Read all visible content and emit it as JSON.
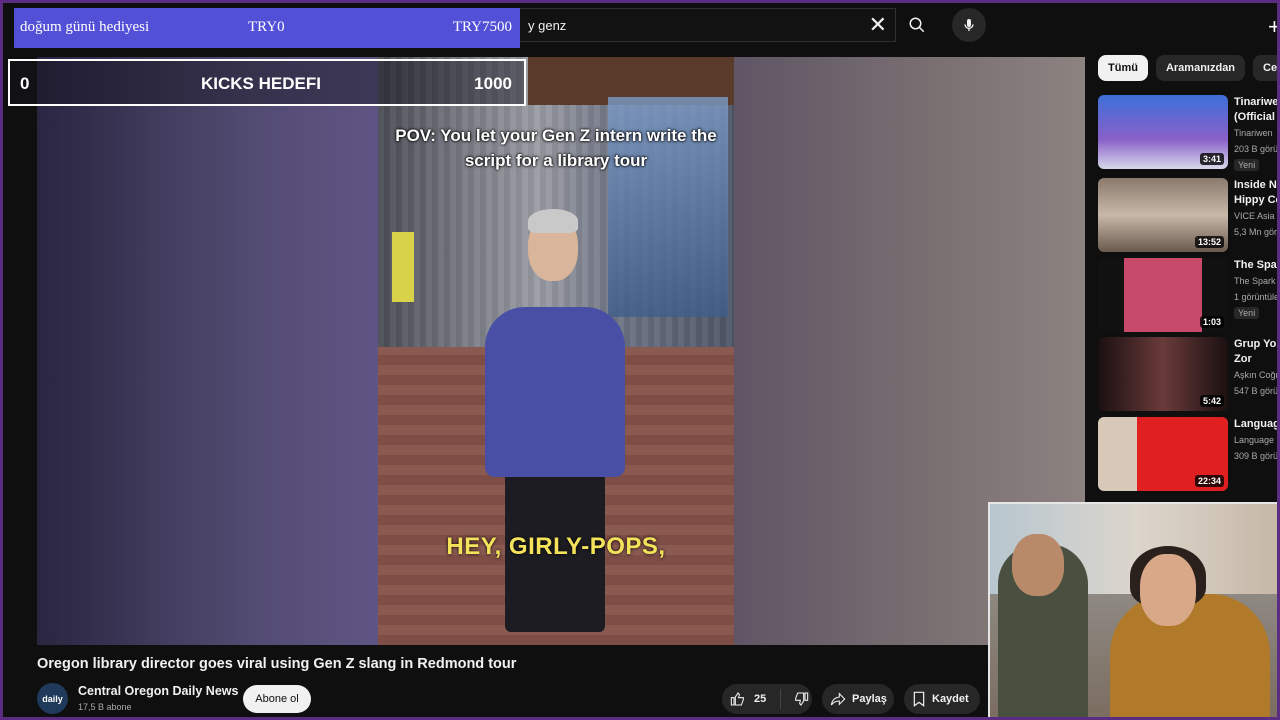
{
  "search": {
    "query": "y genz"
  },
  "overlays": {
    "gift": {
      "label": "doğum günü hediyesi",
      "current": "TRY0",
      "target": "TRY7500"
    },
    "kicks": {
      "min": "0",
      "label": "KICKS HEDEFI",
      "max": "1000"
    }
  },
  "video": {
    "caption_top": "POV: You let your Gen Z intern write the script for a library tour",
    "caption_bottom": "HEY, GIRLY-POPS,",
    "title": "Oregon library director goes viral using Gen Z slang in Redmond tour",
    "channel": {
      "name": "Central Oregon Daily News",
      "subscribers": "17,5 B abone",
      "avatar_text": "daily"
    },
    "subscribe_label": "Abone ol",
    "likes": "25",
    "share_label": "Paylaş",
    "save_label": "Kaydet"
  },
  "chips": [
    "Tümü",
    "Aramanızdan",
    "Centra"
  ],
  "recommendations": [
    {
      "title1": "Tinariwen",
      "title2": "(Official M",
      "channel": "Tinariwen",
      "views": "203 B görü",
      "new": "Yeni",
      "duration": "3:41"
    },
    {
      "title1": "Inside Ne",
      "title2": "Hippy Co",
      "channel": "VICE Asia",
      "views": "5,3 Mn gör",
      "new": "",
      "duration": "13:52"
    },
    {
      "title1": "The Spark",
      "title2": "",
      "channel": "The Spark",
      "views": "1 görüntüle",
      "new": "Yeni",
      "duration": "1:03"
    },
    {
      "title1": "Grup Yoru",
      "title2": "Zor",
      "channel": "Aşkın Coğr",
      "views": "547 B görü",
      "new": "",
      "duration": "5:42"
    },
    {
      "title1": "Language",
      "title2": "",
      "channel": "Language S",
      "views": "309 B görü",
      "new": "",
      "duration": "22:34"
    }
  ],
  "colors": {
    "overlay_purple": "#5350d8",
    "frame_border": "#5b2d82"
  }
}
